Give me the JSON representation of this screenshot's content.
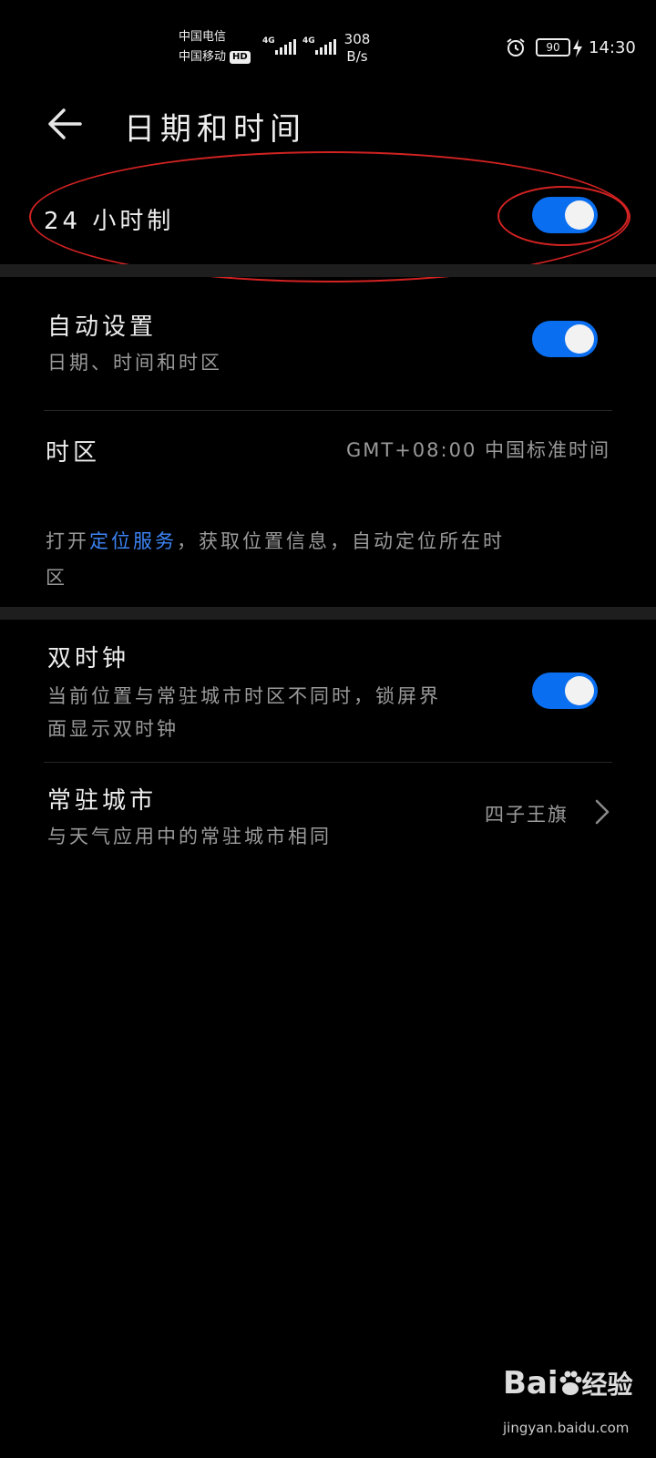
{
  "status_bar": {
    "carrier1": "中国电信",
    "carrier2": "中国移动",
    "hd": "HD",
    "net1": "4G",
    "net2": "4G",
    "speed_value": "308",
    "speed_unit": "B/s",
    "battery": "90",
    "time": "14:30",
    "icons": [
      "alarm-icon",
      "charging-icon"
    ]
  },
  "header": {
    "back_icon": "arrow-left-icon",
    "title": "日期和时间"
  },
  "hour24": {
    "label": "24 小时制",
    "enabled": true
  },
  "auto_set": {
    "title": "自动设置",
    "subtitle": "日期、时间和时区",
    "enabled": true
  },
  "timezone": {
    "title": "时区",
    "value": "GMT+08:00 中国标准时间",
    "hint_prefix": "打开",
    "hint_link": "定位服务",
    "hint_line1_rest": "，获取位置信息，自动定位所在时",
    "hint_line2": "区"
  },
  "dual_clock": {
    "title": "双时钟",
    "subtitle_line1": "当前位置与常驻城市时区不同时，锁屏界",
    "subtitle_line2": "面显示双时钟",
    "enabled": true
  },
  "home_city": {
    "title": "常驻城市",
    "subtitle": "与天气应用中的常驻城市相同",
    "value": "四子王旗",
    "chevron_icon": "chevron-right-icon"
  },
  "watermark": {
    "logo_left": "Bai",
    "logo_right": "经验",
    "url": "jingyan.baidu.com"
  },
  "colors": {
    "background": "#000000",
    "toggle_on": "#0a6ef0",
    "link": "#3d84f5",
    "annotation": "#d22222"
  }
}
